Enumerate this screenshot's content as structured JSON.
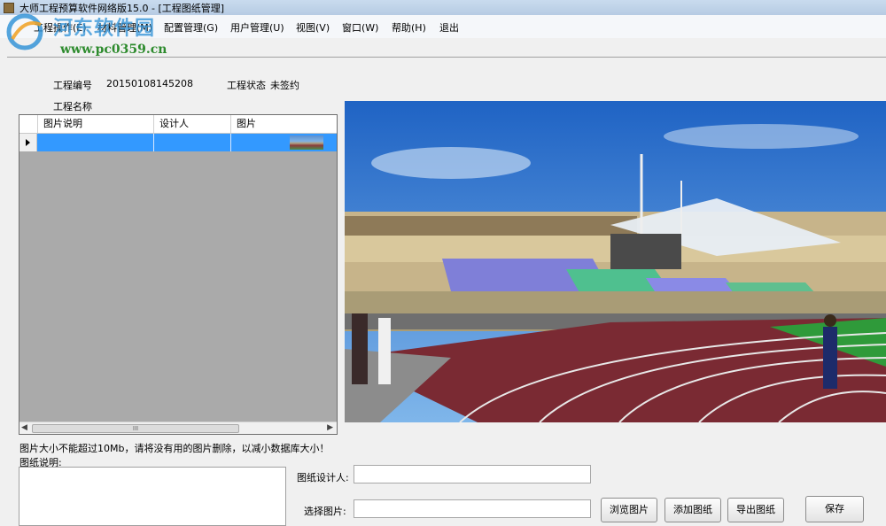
{
  "window": {
    "title": "大师工程预算软件网络版15.0 - [工程图纸管理]"
  },
  "menu": [
    {
      "label": "工程操作(E)"
    },
    {
      "label": "材料管理(M)"
    },
    {
      "label": "配置管理(G)"
    },
    {
      "label": "用户管理(U)"
    },
    {
      "label": "视图(V)"
    },
    {
      "label": "窗口(W)"
    },
    {
      "label": "帮助(H)"
    },
    {
      "label": "退出"
    }
  ],
  "watermark": {
    "name": "河东软件园",
    "url": "www.pc0359.cn"
  },
  "project": {
    "number_label": "工程编号",
    "number_value": "20150108145208",
    "status_label": "工程状态",
    "status_value": "未签约",
    "name_label": "工程名称",
    "name_value": ""
  },
  "grid": {
    "columns": [
      "图片说明",
      "设计人",
      "图片"
    ],
    "rows": [
      {
        "desc": "",
        "designer": "",
        "image": "stadium-thumbnail"
      }
    ],
    "scrollbar_thumb": "III"
  },
  "notice": "图片大小不能超过10Mb，请将没有用的图片删除，以减小数据库大小！",
  "form": {
    "desc_label": "图纸说明:",
    "desc_value": "",
    "designer_label": "图纸设计人:",
    "designer_value": "",
    "select_label": "选择图片:",
    "select_value": ""
  },
  "buttons": {
    "browse": "浏览图片",
    "add": "添加图纸",
    "export": "导出图纸",
    "save": "保存"
  },
  "colors": {
    "selection": "#3399ff",
    "grid_bg": "#aaaaaa"
  }
}
